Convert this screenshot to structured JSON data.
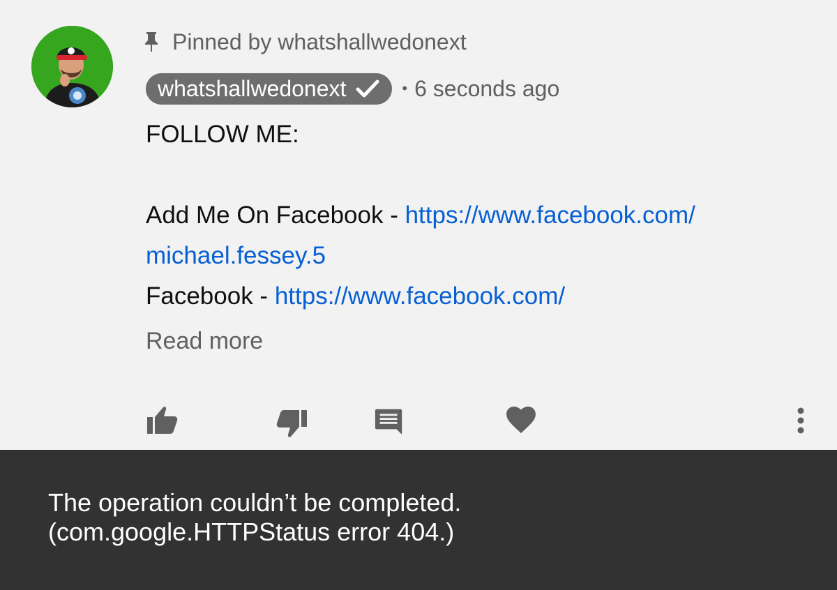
{
  "comment": {
    "pinned_label": "Pinned by whatshallwedonext",
    "author": "whatshallwedonext",
    "separator": "•",
    "timestamp": "6 seconds ago",
    "body": {
      "line1": "FOLLOW ME:",
      "line3_prefix": "Add Me On Facebook - ",
      "line3_link": "https://www.facebook.com/",
      "line4_link": "michael.fessey.5",
      "line5_prefix": "Facebook - ",
      "line5_link": "https://www.facebook.com/"
    },
    "read_more": "Read more",
    "actions": {
      "like_icon": "thumbs-up-icon",
      "dislike_icon": "thumbs-down-icon",
      "reply_icon": "comment-icon",
      "heart_icon": "heart-icon",
      "more_icon": "more-vert-icon"
    }
  },
  "toast": {
    "line1": "The operation couldn’t be completed.",
    "line2": "(com.google.HTTPStatus error 404.)"
  },
  "colors": {
    "background": "#f2f2f2",
    "link": "#065fd4",
    "secondary_text": "#606060",
    "badge": "#6e6e6e",
    "toast_bg": "#323232",
    "avatar_bg": "#37a61f"
  }
}
